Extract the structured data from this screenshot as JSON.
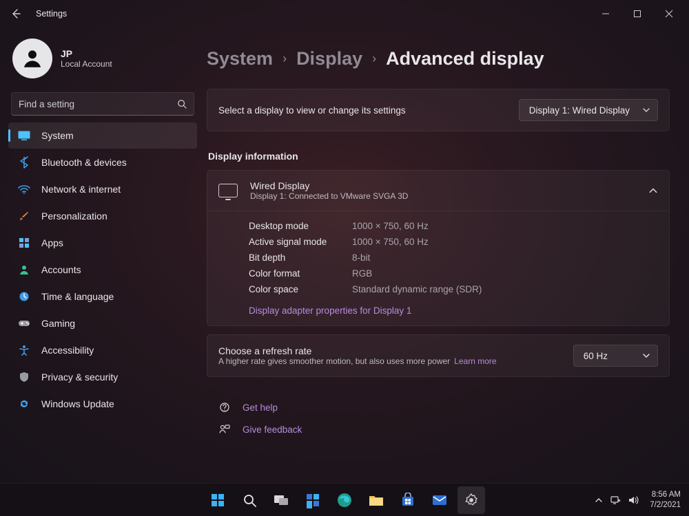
{
  "window": {
    "title": "Settings"
  },
  "profile": {
    "initials": "JP",
    "account_type": "Local Account"
  },
  "search": {
    "placeholder": "Find a setting"
  },
  "nav": [
    {
      "label": "System",
      "active": true
    },
    {
      "label": "Bluetooth & devices"
    },
    {
      "label": "Network & internet"
    },
    {
      "label": "Personalization"
    },
    {
      "label": "Apps"
    },
    {
      "label": "Accounts"
    },
    {
      "label": "Time & language"
    },
    {
      "label": "Gaming"
    },
    {
      "label": "Accessibility"
    },
    {
      "label": "Privacy & security"
    },
    {
      "label": "Windows Update"
    }
  ],
  "breadcrumb": {
    "l1": "System",
    "l2": "Display",
    "l3": "Advanced display"
  },
  "select_display": {
    "label": "Select a display to view or change its settings",
    "value": "Display 1: Wired Display"
  },
  "section_info_title": "Display information",
  "display_info": {
    "name": "Wired Display",
    "sub": "Display 1: Connected to VMware SVGA 3D",
    "rows": [
      {
        "k": "Desktop mode",
        "v": "1000 × 750, 60 Hz"
      },
      {
        "k": "Active signal mode",
        "v": "1000 × 750, 60 Hz"
      },
      {
        "k": "Bit depth",
        "v": "8-bit"
      },
      {
        "k": "Color format",
        "v": "RGB"
      },
      {
        "k": "Color space",
        "v": "Standard dynamic range (SDR)"
      }
    ],
    "adapter_link": "Display adapter properties for Display 1"
  },
  "refresh": {
    "title": "Choose a refresh rate",
    "sub": "A higher rate gives smoother motion, but also uses more power",
    "learn": "Learn more",
    "value": "60 Hz"
  },
  "help": {
    "get_help": "Get help",
    "give_feedback": "Give feedback"
  },
  "taskbar": {
    "time": "8:56 AM",
    "date": "7/2/2021"
  }
}
